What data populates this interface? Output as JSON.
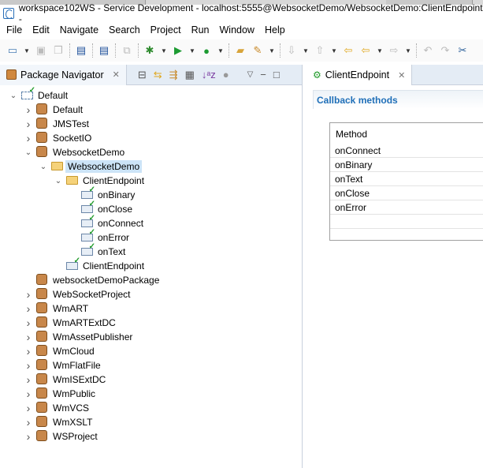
{
  "window": {
    "title": "workspace102WS - Service Development - localhost:5555@WebsocketDemo/WebsocketDemo:ClientEndpoint - "
  },
  "menu": [
    "File",
    "Edit",
    "Navigate",
    "Search",
    "Project",
    "Run",
    "Window",
    "Help"
  ],
  "navigator": {
    "tab_label": "Package Navigator",
    "tree": [
      {
        "label": "Default",
        "level": 0,
        "type": "server",
        "expanded": true
      },
      {
        "label": "Default",
        "level": 1,
        "type": "package",
        "expanded": false
      },
      {
        "label": "JMSTest",
        "level": 1,
        "type": "package",
        "expanded": false
      },
      {
        "label": "SocketIO",
        "level": 1,
        "type": "package",
        "expanded": false
      },
      {
        "label": "WebsocketDemo",
        "level": 1,
        "type": "package",
        "expanded": true
      },
      {
        "label": "WebsocketDemo",
        "level": 2,
        "type": "folder",
        "expanded": true,
        "selected": true
      },
      {
        "label": "ClientEndpoint",
        "level": 3,
        "type": "folder",
        "expanded": true
      },
      {
        "label": "onBinary",
        "level": 4,
        "type": "service"
      },
      {
        "label": "onClose",
        "level": 4,
        "type": "service"
      },
      {
        "label": "onConnect",
        "level": 4,
        "type": "service"
      },
      {
        "label": "onError",
        "level": 4,
        "type": "service"
      },
      {
        "label": "onText",
        "level": 4,
        "type": "service"
      },
      {
        "label": "ClientEndpoint",
        "level": 3,
        "type": "endpoint"
      },
      {
        "label": "websocketDemoPackage",
        "level": 1,
        "type": "package"
      },
      {
        "label": "WebSocketProject",
        "level": 1,
        "type": "package",
        "expanded": false
      },
      {
        "label": "WmART",
        "level": 1,
        "type": "package",
        "expanded": false
      },
      {
        "label": "WmARTExtDC",
        "level": 1,
        "type": "package",
        "expanded": false
      },
      {
        "label": "WmAssetPublisher",
        "level": 1,
        "type": "package",
        "expanded": false
      },
      {
        "label": "WmCloud",
        "level": 1,
        "type": "package",
        "expanded": false
      },
      {
        "label": "WmFlatFile",
        "level": 1,
        "type": "package",
        "expanded": false
      },
      {
        "label": "WmISExtDC",
        "level": 1,
        "type": "package",
        "expanded": false
      },
      {
        "label": "WmPublic",
        "level": 1,
        "type": "package",
        "expanded": false
      },
      {
        "label": "WmVCS",
        "level": 1,
        "type": "package",
        "expanded": false
      },
      {
        "label": "WmXSLT",
        "level": 1,
        "type": "package",
        "expanded": false
      },
      {
        "label": "WSProject",
        "level": 1,
        "type": "package",
        "expanded": false
      }
    ]
  },
  "editor": {
    "tab_label": "ClientEndpoint",
    "section_title": "Callback methods",
    "table_header": "Method",
    "methods": [
      "onConnect",
      "onBinary",
      "onText",
      "onClose",
      "onError"
    ]
  }
}
